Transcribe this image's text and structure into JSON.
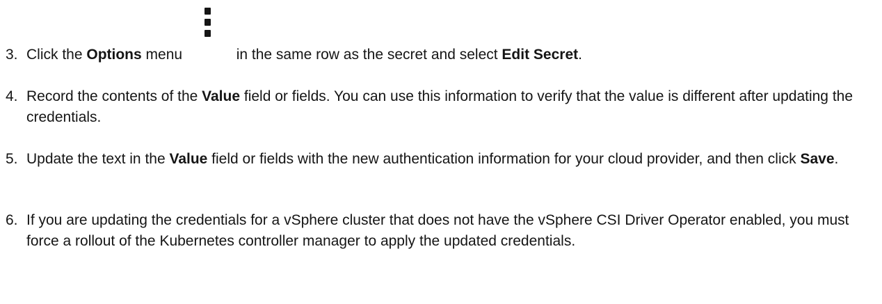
{
  "steps": [
    {
      "number": "3.",
      "parts": [
        {
          "t": "Click the "
        },
        {
          "b": "Options"
        },
        {
          "t": " menu "
        },
        {
          "icon": "kebab-options-icon"
        },
        {
          "t": " in the same row as the secret and select "
        },
        {
          "b": "Edit Secret"
        },
        {
          "t": "."
        }
      ]
    },
    {
      "number": "4.",
      "parts": [
        {
          "t": "Record the contents of the "
        },
        {
          "b": "Value"
        },
        {
          "t": " field or fields. You can use this information to verify that the value is different after updating the credentials."
        }
      ]
    },
    {
      "number": "5.",
      "parts": [
        {
          "t": "Update the text in the "
        },
        {
          "b": "Value"
        },
        {
          "t": " field or fields with the new authentication information for your cloud provider, and then click "
        },
        {
          "b": "Save"
        },
        {
          "t": "."
        }
      ]
    },
    {
      "number": "6.",
      "parts": [
        {
          "t": "If you are updating the credentials for a vSphere cluster that does not have the vSphere CSI Driver Operator enabled, you must force a rollout of the Kubernetes controller manager to apply the updated credentials."
        }
      ]
    }
  ]
}
